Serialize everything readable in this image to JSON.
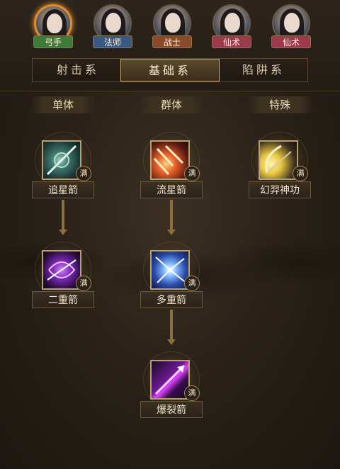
{
  "characters": [
    {
      "label": "弓手",
      "color": "#3f7a3a",
      "active": true
    },
    {
      "label": "法师",
      "color": "#3a5a84",
      "active": false
    },
    {
      "label": "战士",
      "color": "#8a4a2a",
      "active": false
    },
    {
      "label": "仙术",
      "color": "#9a3a4a",
      "active": false
    },
    {
      "label": "仙术",
      "color": "#9a3a4a",
      "active": false
    }
  ],
  "tabs": [
    {
      "label": "射击系",
      "active": false
    },
    {
      "label": "基础系",
      "active": true
    },
    {
      "label": "陷阱系",
      "active": false
    }
  ],
  "columns": [
    "单体",
    "群体",
    "特殊"
  ],
  "skills": {
    "zhuixing": {
      "name": "追星箭",
      "status": "满"
    },
    "liuxing": {
      "name": "流星箭",
      "status": "满"
    },
    "huanyi": {
      "name": "幻羿神功",
      "status": "满"
    },
    "erchong": {
      "name": "二重箭",
      "status": "满"
    },
    "duochong": {
      "name": "多重箭",
      "status": "满"
    },
    "baolie": {
      "name": "爆裂箭",
      "status": "满"
    }
  }
}
